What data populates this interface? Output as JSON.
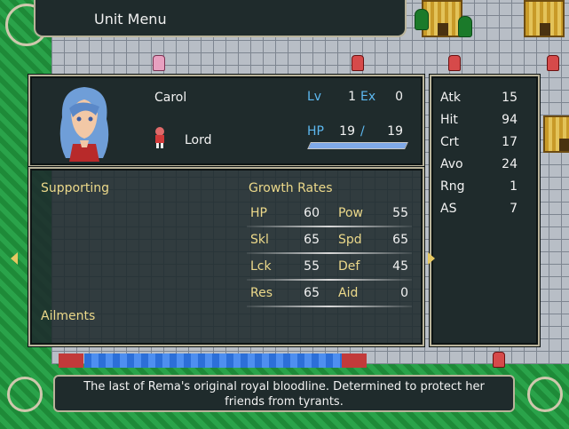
{
  "menu": {
    "title": "Unit Menu"
  },
  "unit": {
    "name": "Carol",
    "class": "Lord",
    "lv_label": "Lv",
    "lv": "1",
    "ex_label": "Ex",
    "ex": "0",
    "hp_label": "HP",
    "hp_current": "19",
    "hp_sep": "/",
    "hp_max": "19",
    "hp_fraction": 1.0
  },
  "combat_stats": [
    {
      "label": "Atk",
      "value": "15"
    },
    {
      "label": "Hit",
      "value": "94"
    },
    {
      "label": "Crt",
      "value": "17"
    },
    {
      "label": "Avo",
      "value": "24"
    },
    {
      "label": "Rng",
      "value": "1"
    },
    {
      "label": "AS",
      "value": "7"
    }
  ],
  "sections": {
    "supporting": "Supporting",
    "ailments": "Ailments",
    "growth_rates": "Growth Rates"
  },
  "growth": [
    {
      "label": "HP",
      "value": "60"
    },
    {
      "label": "Pow",
      "value": "55"
    },
    {
      "label": "Skl",
      "value": "65"
    },
    {
      "label": "Spd",
      "value": "65"
    },
    {
      "label": "Lck",
      "value": "55"
    },
    {
      "label": "Def",
      "value": "45"
    },
    {
      "label": "Res",
      "value": "65"
    },
    {
      "label": "Aid",
      "value": "0"
    }
  ],
  "description": {
    "line1": "The last of Rema's original royal bloodline.  Determined to protect her",
    "line2": "friends from tyrants."
  },
  "icons": {
    "prev": "arrow-left-icon",
    "next": "arrow-right-icon"
  }
}
